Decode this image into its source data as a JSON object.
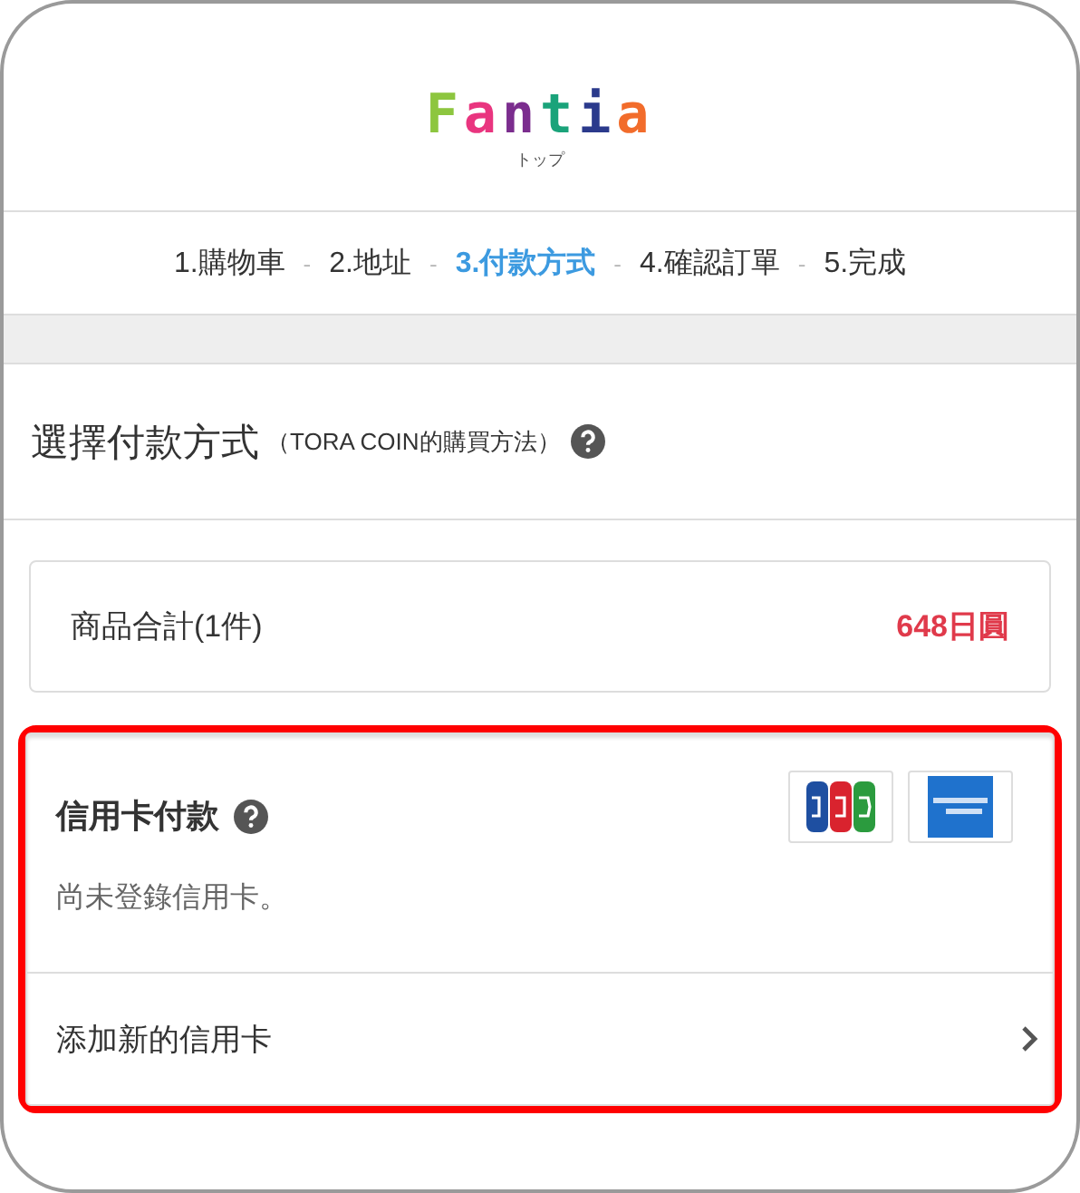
{
  "header": {
    "logo": "Fantia",
    "logo_caption": "トップ"
  },
  "steps": [
    {
      "label": "1.購物車",
      "selected": false
    },
    {
      "label": "2.地址",
      "selected": false
    },
    {
      "label": "3.付款方式",
      "selected": true
    },
    {
      "label": "4.確認訂單",
      "selected": false
    },
    {
      "label": "5.完成",
      "selected": false
    }
  ],
  "step_separators": [
    "-",
    "-",
    "-",
    "-"
  ],
  "section": {
    "title": "選擇付款方式",
    "note": "（TORA COIN的購買方法）"
  },
  "summary": {
    "label": "商品合計(1件)",
    "amount": "648日圓"
  },
  "credit_card": {
    "title": "信用卡付款",
    "highlighted": true,
    "status": "尚未登錄信用卡。",
    "add_link": "添加新的信用卡"
  }
}
